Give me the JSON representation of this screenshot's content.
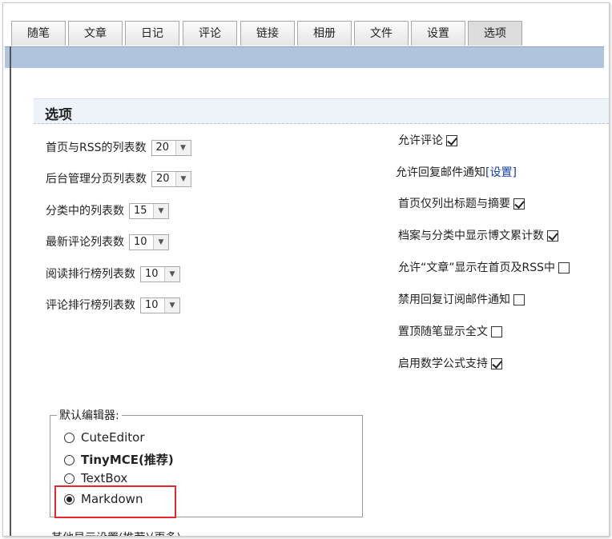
{
  "tabs": [
    "随笔",
    "文章",
    "日记",
    "评论",
    "链接",
    "相册",
    "文件",
    "设置",
    "选项"
  ],
  "active_tab": "选项",
  "section_title": "选项",
  "list_settings": [
    {
      "label": "首页与RSS的列表数",
      "value": "20"
    },
    {
      "label": "后台管理分页列表数",
      "value": "20"
    },
    {
      "label": "分类中的列表数",
      "value": "15"
    },
    {
      "label": "最新评论列表数",
      "value": "10"
    },
    {
      "label": "阅读排行榜列表数",
      "value": "10"
    },
    {
      "label": "评论排行榜列表数",
      "value": "10"
    }
  ],
  "options": [
    {
      "label": "允许评论",
      "checked": true
    },
    {
      "label": "允许回复邮件通知",
      "link": "[设置]"
    },
    {
      "label": "首页仅列出标题与摘要",
      "checked": true
    },
    {
      "label": "档案与分类中显示博文累计数",
      "checked": true
    },
    {
      "label": "允许“文章”显示在首页及RSS中",
      "checked": false
    },
    {
      "label": "禁用回复订阅邮件通知",
      "checked": false
    },
    {
      "label": "置顶随笔显示全文",
      "checked": false
    },
    {
      "label": "启用数学公式支持",
      "checked": true
    }
  ],
  "editor": {
    "legend": "默认编辑器:",
    "choices": [
      {
        "label": "CuteEditor",
        "selected": false,
        "bold": false
      },
      {
        "label": "TinyMCE(推荐)",
        "selected": false,
        "bold": true
      },
      {
        "label": "TextBox",
        "selected": false,
        "bold": false
      },
      {
        "label": "Markdown",
        "selected": true,
        "bold": false
      }
    ]
  },
  "cut_off_text": "其他显示设置(推荐)(更多)",
  "colors": {
    "tab_bar": "#b0c4de",
    "section_bg": "#edf3f8",
    "highlight": "#e1282e",
    "link": "#1a3d9e"
  }
}
